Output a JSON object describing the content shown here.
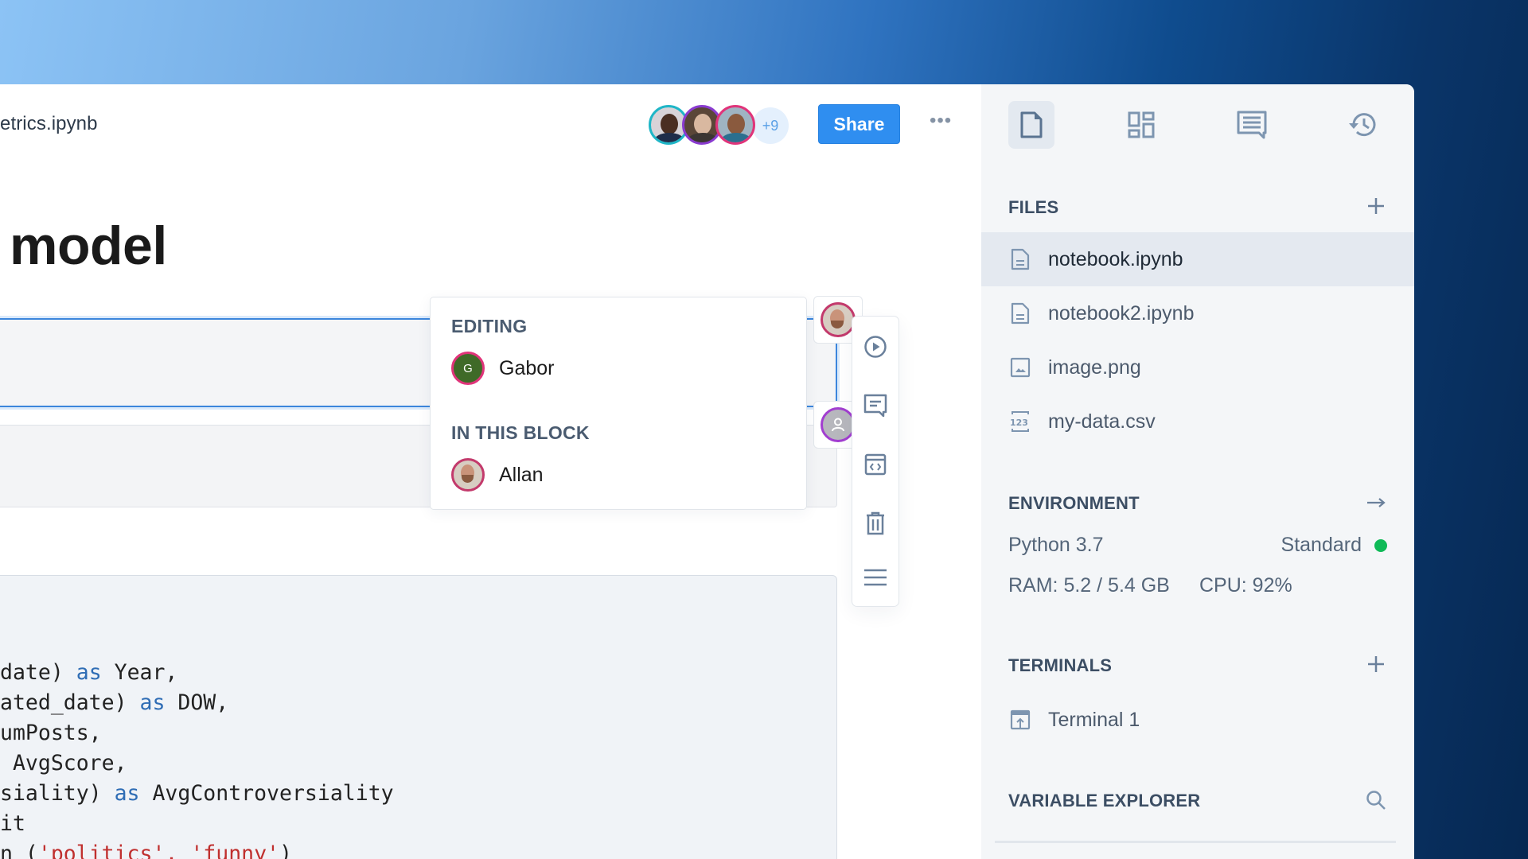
{
  "header": {
    "title": "etrics.ipynb",
    "collaborators": [
      {
        "name": "collaborator-1",
        "ring_color": "#1fb6c7"
      },
      {
        "name": "collaborator-2",
        "ring_color": "#8a3bd0"
      },
      {
        "name": "collaborator-3",
        "ring_color": "#e0347a"
      }
    ],
    "more_collaborators": "+9",
    "share_label": "Share",
    "more_menu": "•••"
  },
  "notebook": {
    "heading": "model",
    "code_lines": [
      [
        {
          "t": "date) "
        },
        {
          "t": "as",
          "c": "kw"
        },
        {
          "t": " Year,"
        }
      ],
      [
        {
          "t": "ated_date) "
        },
        {
          "t": "as",
          "c": "kw"
        },
        {
          "t": " DOW,"
        }
      ],
      [
        {
          "t": "umPosts,"
        }
      ],
      [
        {
          "t": " AvgScore,"
        }
      ],
      [
        {
          "t": "siality) "
        },
        {
          "t": "as",
          "c": "kw"
        },
        {
          "t": " AvgControversiality"
        }
      ],
      [
        {
          "t": "it"
        }
      ],
      [
        {
          "t": "n ("
        },
        {
          "t": "'politics', 'funny'",
          "c": "str"
        },
        {
          "t": ")"
        }
      ]
    ]
  },
  "presence_popover": {
    "editing_label": "EDITING",
    "editing_user": {
      "name": "Gabor",
      "initial": "G"
    },
    "in_block_label": "IN THIS BLOCK",
    "in_block_user": {
      "name": "Allan"
    }
  },
  "block_toolbar": {
    "actions": [
      "run",
      "comment",
      "embed",
      "delete",
      "more"
    ]
  },
  "sidebar": {
    "tabs": [
      "files",
      "blocks",
      "comments",
      "history"
    ],
    "active_tab": "files",
    "files": {
      "title": "FILES",
      "items": [
        {
          "name": "notebook.ipynb",
          "icon": "notebook-file-icon",
          "selected": true
        },
        {
          "name": "notebook2.ipynb",
          "icon": "notebook-file-icon",
          "selected": false
        },
        {
          "name": "image.png",
          "icon": "image-file-icon",
          "selected": false
        },
        {
          "name": "my-data.csv",
          "icon": "csv-file-icon",
          "selected": false
        }
      ]
    },
    "environment": {
      "title": "ENVIRONMENT",
      "runtime": "Python 3.7",
      "machine": "Standard",
      "status_color": "#0fba57",
      "ram": "RAM: 5.2 / 5.4 GB",
      "cpu": "CPU: 92%"
    },
    "terminals": {
      "title": "TERMINALS",
      "items": [
        "Terminal 1"
      ]
    },
    "variable_explorer": {
      "title": "VARIABLE EXPLORER"
    }
  }
}
